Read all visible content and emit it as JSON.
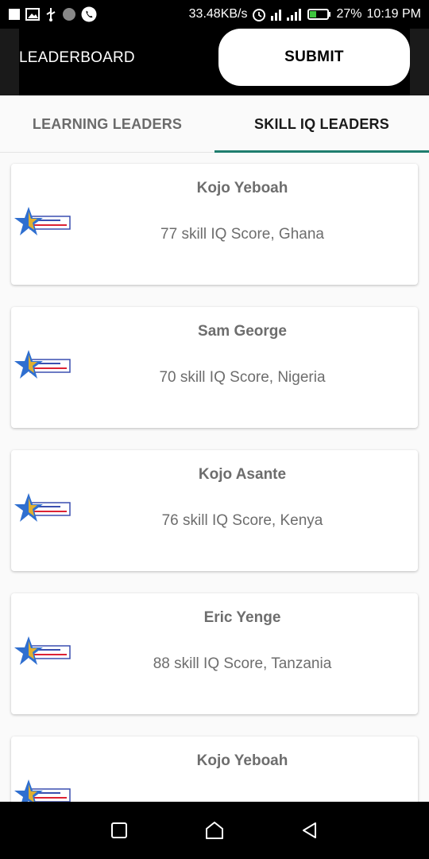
{
  "status_bar": {
    "net_speed": "33.48KB/s",
    "battery": "27%",
    "time": "10:19 PM",
    "icons_left": [
      "notification-square-icon",
      "image-icon",
      "usb-icon",
      "circle-icon",
      "phone-icon"
    ],
    "icons_right": [
      "alarm-icon",
      "signal-icon",
      "battery-icon"
    ]
  },
  "app_bar": {
    "title": "LEADERBOARD",
    "submit_label": "SUBMIT"
  },
  "tabs": [
    {
      "label": "LEARNING LEADERS",
      "selected": false
    },
    {
      "label": "SKILL IQ LEADERS",
      "selected": true
    }
  ],
  "leaders": [
    {
      "name": "Kojo Yeboah",
      "score_text": "77 skill IQ Score, Ghana"
    },
    {
      "name": "Sam George",
      "score_text": "70 skill IQ Score, Nigeria"
    },
    {
      "name": "Kojo Asante",
      "score_text": "76 skill IQ Score, Kenya"
    },
    {
      "name": "Eric Yenge",
      "score_text": "88 skill IQ Score, Tanzania"
    },
    {
      "name": "Kojo Yeboah",
      "score_text": ""
    }
  ],
  "colors": {
    "accent": "#1e7d6e",
    "appbar": "#000000",
    "card_text": "#6d6d6d",
    "badge_star_blue": "#2f6fd0",
    "badge_star_gold": "#e0b030"
  },
  "badge_icon": "skill-iq-badge-icon"
}
